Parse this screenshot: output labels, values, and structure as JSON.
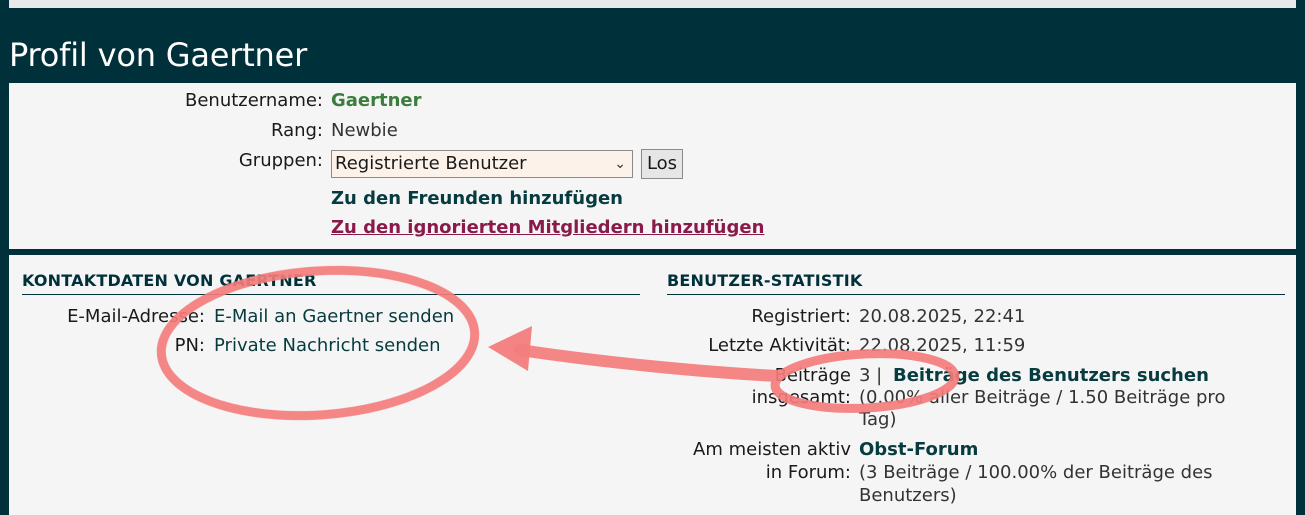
{
  "profile_title": "Profil von Gaertner",
  "top": {
    "username_label": "Benutzername:",
    "username": "Gaertner",
    "rank_label": "Rang:",
    "rank": "Newbie",
    "groups_label": "Gruppen:",
    "groups_selected": "Registrierte Benutzer",
    "go_button": "Los",
    "add_friend": "Zu den Freunden hinzufügen",
    "add_ignore": "Zu den ignorierten Mitgliedern hinzufügen"
  },
  "contact": {
    "heading": "KONTAKTDATEN VON GAERTNER",
    "email_label": "E-Mail-Adresse:",
    "email_link": "E-Mail an Gaertner senden",
    "pm_label": "PN:",
    "pm_link": "Private Nachricht senden"
  },
  "stats": {
    "heading": "BENUTZER-STATISTIK",
    "registered_label": "Registriert:",
    "registered_value": "20.08.2025, 22:41",
    "last_activity_label": "Letzte Aktivität:",
    "last_activity_value": "22.08.2025, 11:59",
    "posts_label_1": "Beiträge",
    "posts_label_2": "insgesamt:",
    "posts_count": "3 |",
    "posts_search_link": "Beiträge des Benutzers suchen",
    "posts_detail_1": "(0.00% aller Beiträge / 1.50 Beiträge pro",
    "posts_detail_2": "Tag)",
    "most_active_label_1": "Am meisten aktiv",
    "most_active_label_2": "in Forum:",
    "most_active_forum": "Obst-Forum",
    "most_active_detail_1": "(3 Beiträge / 100.00% der Beiträge des",
    "most_active_detail_2": "Benutzers)"
  },
  "colors": {
    "background": "#00313a",
    "panel": "#f5f5f5",
    "username": "#3b7d3e",
    "ignore_link": "#8a1a4a",
    "annotation": "#f37c7c"
  }
}
